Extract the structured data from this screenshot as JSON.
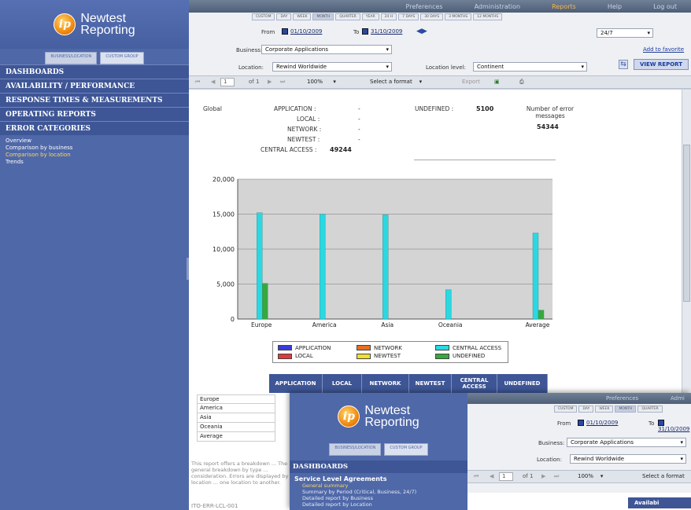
{
  "app": {
    "brand_line1": "Newtest",
    "brand_line2": "Reporting",
    "logo_letters": "ip"
  },
  "top_menu": [
    "Preferences",
    "Administration",
    "Reports",
    "Help",
    "Log out"
  ],
  "top_menu_active": "Reports",
  "period_buttons": [
    "CUSTOM",
    "DAY",
    "WEEK",
    "MONTH",
    "QUARTER",
    "YEAR",
    "24 H",
    "7 DAYS",
    "30 DAYS",
    "3 MONTHS",
    "12 MONTHS"
  ],
  "period_active": "MONTH",
  "sidebar": {
    "mode_buttons": [
      "BUSINESS/LOCATION",
      "CUSTOM GROUP"
    ],
    "categories": [
      "DASHBOARDS",
      "AVAILABILITY / PERFORMANCE",
      "RESPONSE TIMES & MEASUREMENTS",
      "OPERATING REPORTS",
      "ERROR CATEGORIES"
    ],
    "sub_items": [
      "Overview",
      "Comparison by business",
      "Comparison by location",
      "Trends"
    ],
    "sub_active": "Comparison by location"
  },
  "filters": {
    "from_label": "From",
    "from_date": "01/10/2009",
    "to_label": "To",
    "to_date": "31/10/2009",
    "schedule": "24/7",
    "business_label": "Business:",
    "business_value": "Corporate Applications",
    "location_label": "Location:",
    "location_value": "Rewind Worldwide",
    "location_level_label": "Location level:",
    "location_level_value": "Continent",
    "add_favorite": "Add to favorite",
    "view_report": "VIEW REPORT"
  },
  "toolbar": {
    "page_value": "1",
    "page_of": "of 1",
    "zoom": "100%",
    "format": "Select a format",
    "export": "Export"
  },
  "summary": {
    "scope": "Global",
    "application_label": "APPLICATION :",
    "application_value": "-",
    "local_label": "LOCAL :",
    "local_value": "-",
    "network_label": "NETWORK :",
    "network_value": "-",
    "newtest_label": "NEWTEST :",
    "newtest_value": "-",
    "central_label": "CENTRAL ACCESS :",
    "central_value": "49244",
    "undefined_label": "UNDEFINED :",
    "undefined_value": "5100",
    "errors_label": "Number of error messages",
    "errors_value": "54344"
  },
  "chart_data": {
    "type": "bar",
    "categories": [
      "Europe",
      "America",
      "Asia",
      "Oceania",
      "Average"
    ],
    "ylim": [
      0,
      20000
    ],
    "yticks": [
      "0",
      "5,000",
      "10,000",
      "15,000",
      "20,000"
    ],
    "series": [
      {
        "name": "APPLICATION",
        "color": "#3a3adc",
        "values": [
          0,
          0,
          0,
          0,
          0
        ]
      },
      {
        "name": "LOCAL",
        "color": "#e23a3a",
        "values": [
          0,
          0,
          0,
          0,
          0
        ]
      },
      {
        "name": "NETWORK",
        "color": "#e5701f",
        "values": [
          0,
          0,
          0,
          0,
          0
        ]
      },
      {
        "name": "NEWTEST",
        "color": "#f0e02a",
        "values": [
          0,
          0,
          0,
          0,
          0
        ]
      },
      {
        "name": "CENTRAL ACCESS",
        "color": "#2ad8e2",
        "values": [
          15200,
          15000,
          14900,
          4200,
          12300
        ]
      },
      {
        "name": "UNDEFINED",
        "color": "#37a83a",
        "values": [
          5100,
          0,
          0,
          0,
          1275
        ]
      }
    ]
  },
  "table": {
    "headers": [
      "APPLICATION",
      "LOCAL",
      "NETWORK",
      "NEWTEST",
      "CENTRAL ACCESS",
      "UNDEFINED"
    ],
    "rows": [
      "Europe",
      "America",
      "Asia",
      "Oceania",
      "Average"
    ]
  },
  "note": "This report offers a breakdown ... The general breakdown by type ... consideration. Errors are displayed by location ... one location to another.",
  "report_code": "ITO-ERR-LCL-001",
  "overlay": {
    "top_menu": [
      "Preferences",
      "Admi"
    ],
    "category": "DASHBOARDS",
    "group_title": "Service Level Agreements",
    "items": [
      "General summary",
      "Summary by Period (Critical, Business, 24/7)",
      "Detailed report by Business",
      "Detailed report by Location"
    ],
    "item_active": "General summary",
    "availability_header": "Availabi"
  }
}
